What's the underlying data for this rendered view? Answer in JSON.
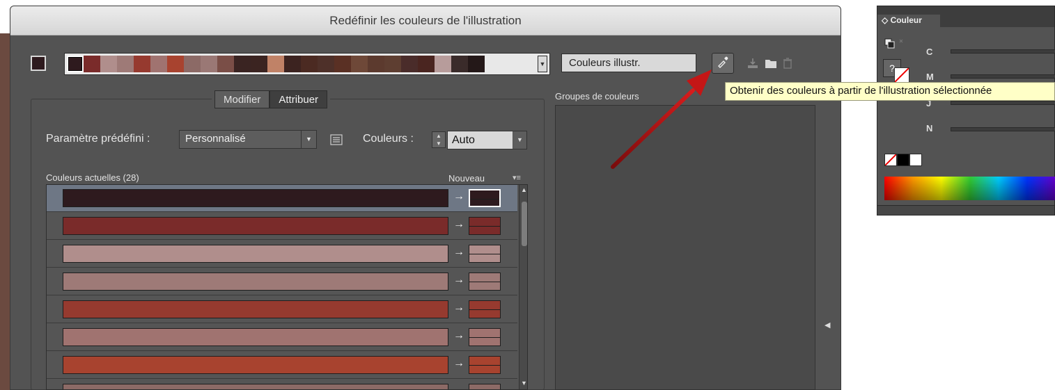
{
  "dialog": {
    "title": "Redéfinir les couleurs de l'illustration",
    "current_color": "#2e1a1e",
    "strip_colors": [
      "#2e1a1e",
      "#7a2b2a",
      "#b08e8c",
      "#9e7a77",
      "#963a2f",
      "#a07370",
      "#a8432f",
      "#8c6a66",
      "#9a7875",
      "#7a4e47",
      "#3a2422",
      "#3b2421",
      "#c08267",
      "#3c2320",
      "#4b2a22",
      "#4e3029",
      "#5a3024",
      "#6e4838",
      "#5c3a2e",
      "#5e3e31",
      "#4a2c2a",
      "#4a2520",
      "#b79c9b",
      "#3a2b2a",
      "#241818"
    ],
    "group_name": "Couleurs illustr.",
    "tabs": [
      "Modifier",
      "Attribuer"
    ],
    "preset_label": "Paramètre prédéfini :",
    "preset_value": "Personnalisé",
    "colors_label": "Couleurs :",
    "colors_value": "Auto",
    "current_colors_header": "Couleurs actuelles (28)",
    "new_header": "Nouveau",
    "rows": [
      {
        "color": "#2e1a1e",
        "selected": true
      },
      {
        "color": "#7a2b2a",
        "selected": false
      },
      {
        "color": "#b08e8c",
        "selected": false
      },
      {
        "color": "#9e7a77",
        "selected": false
      },
      {
        "color": "#963a2f",
        "selected": false
      },
      {
        "color": "#a07370",
        "selected": false
      },
      {
        "color": "#a8432f",
        "selected": false
      },
      {
        "color": "#8c6a66",
        "selected": false
      }
    ],
    "groups_label": "Groupes de couleurs",
    "arrow_glyph": "→"
  },
  "color_panel": {
    "tab_label": "◇ Couleur",
    "q_label": "?",
    "sliders": [
      "C",
      "M",
      "J",
      "N"
    ]
  },
  "tooltip": "Obtenir des couleurs à partir de l'illustration sélectionnée"
}
